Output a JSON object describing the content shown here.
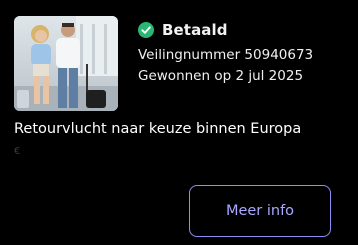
{
  "status": {
    "label": "Betaald",
    "icon": "check-circle-icon",
    "color": "#2bb673"
  },
  "auction": {
    "number_text": "Veilingnummer 50940673",
    "won_text": "Gewonnen op 2 jul 2025"
  },
  "product": {
    "title": "Retourvlucht naar keuze binnen Europa",
    "currency_symbol": "€"
  },
  "actions": {
    "more_info_label": "Meer info"
  },
  "colors": {
    "accent": "#8f8ef5",
    "background": "#000000"
  }
}
